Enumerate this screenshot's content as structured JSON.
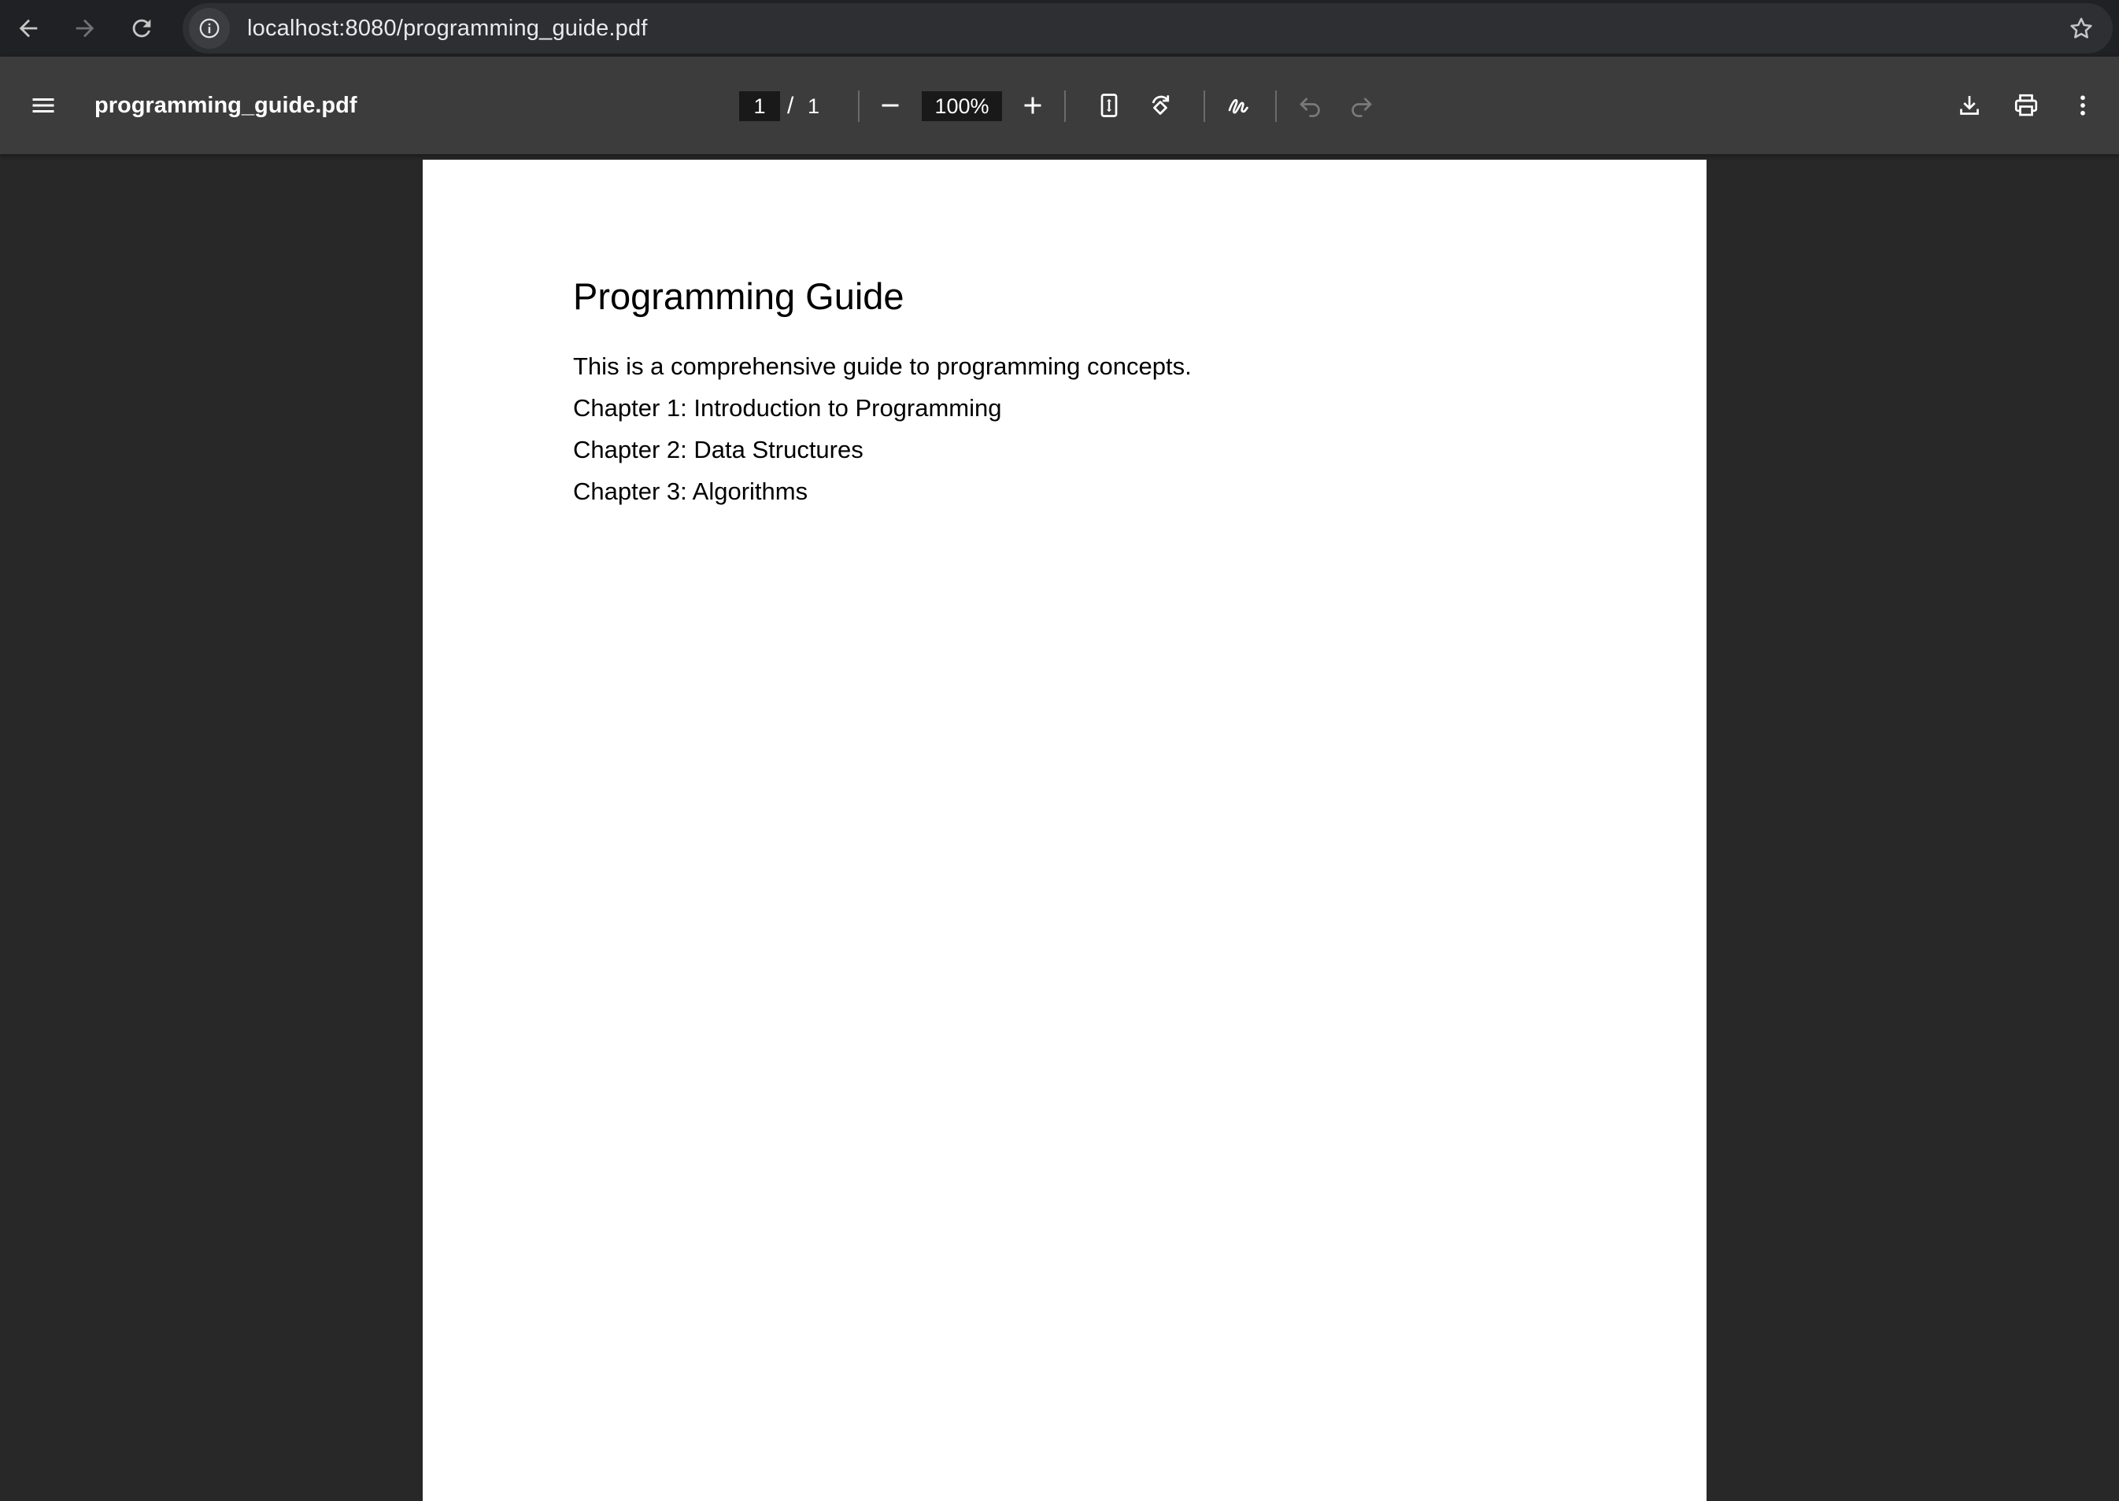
{
  "browser": {
    "url": "localhost:8080/programming_guide.pdf"
  },
  "toolbar": {
    "file_name": "programming_guide.pdf",
    "current_page": "1",
    "page_separator": "/",
    "total_pages": "1",
    "zoom": "100%"
  },
  "document": {
    "title": "Programming Guide",
    "lines": [
      "This is a comprehensive guide to programming concepts.",
      "Chapter 1: Introduction to Programming",
      "Chapter 2: Data Structures",
      "Chapter 3: Algorithms"
    ]
  },
  "icons": {
    "back": "arrow-left-icon",
    "forward": "arrow-right-icon",
    "reload": "reload-icon",
    "site_info": "info-icon",
    "bookmark": "star-icon",
    "menu": "hamburger-menu-icon",
    "zoom_out": "minus-icon",
    "zoom_in": "plus-icon",
    "fit": "fit-page-icon",
    "rotate": "rotate-icon",
    "annotate": "draw-icon",
    "undo": "undo-icon",
    "redo": "redo-icon",
    "download": "download-icon",
    "print": "print-icon",
    "more": "more-vertical-icon"
  },
  "colors": {
    "browser_bar": "#202124",
    "toolbar": "#3c3c3c",
    "viewer_background": "#282828",
    "page": "#ffffff"
  }
}
